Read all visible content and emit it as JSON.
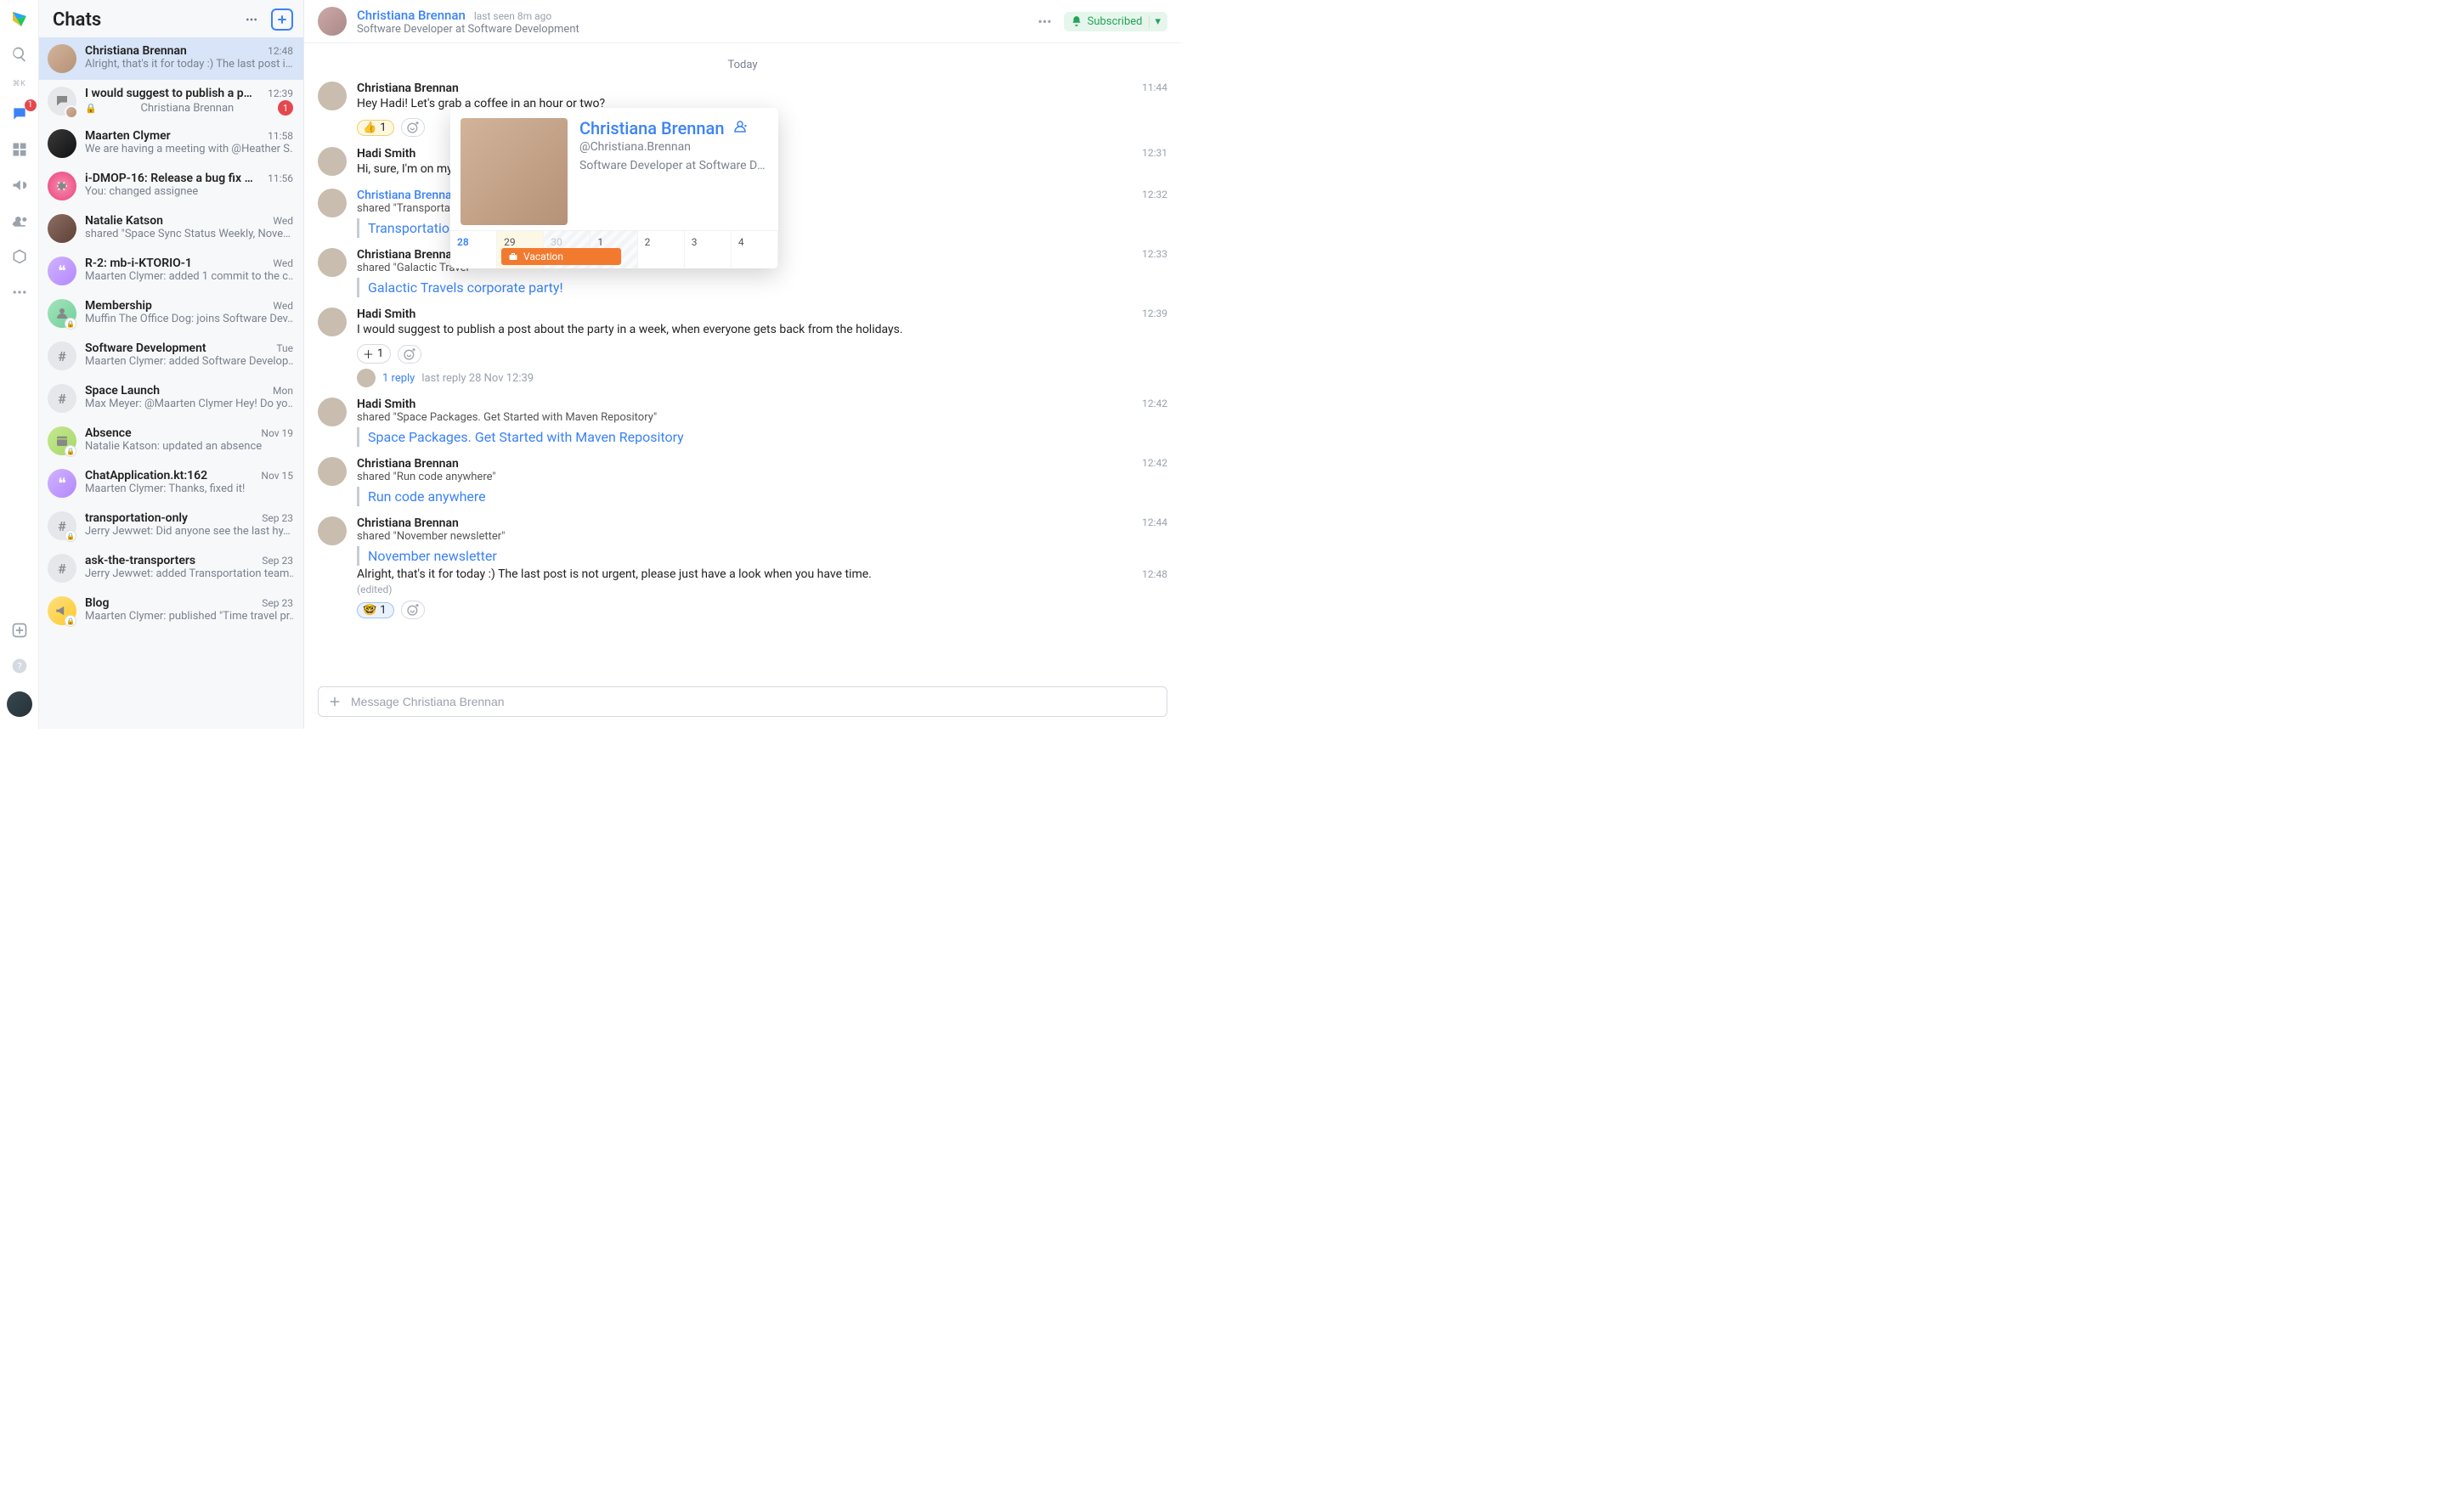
{
  "app": {
    "section_title": "Chats"
  },
  "rail": {
    "chats_badge": "1",
    "shortcut": "⌘K"
  },
  "header": {
    "name": "Christiana Brennan",
    "last_seen": "last seen 8m ago",
    "subtitle": "Software Developer at Software Development",
    "subscribed": "Subscribed"
  },
  "day_label": "Today",
  "composer": {
    "placeholder": "Message Christiana Brennan"
  },
  "chats": [
    {
      "title": "Christiana Brennan",
      "time": "12:48",
      "preview": "Alright, that's it for today :) The last post i…",
      "active": true,
      "avatar": "av-cb"
    },
    {
      "title": "I would suggest to publish a p…",
      "time": "12:39",
      "preview": "Christiana Brennan",
      "lock": true,
      "unread": "1",
      "thread": true,
      "mini": true
    },
    {
      "title": "Maarten Clymer",
      "time": "11:58",
      "preview": "We are having a meeting with @Heather S…",
      "avatar": "av-mc"
    },
    {
      "title": "i-DMOP-16: Release a bug fix …",
      "time": "11:56",
      "preview": "You: changed assignee",
      "avatar": "cv-pink",
      "icon": "bug"
    },
    {
      "title": "Natalie Katson",
      "time": "Wed",
      "preview": "shared \"Space Sync Status Weekly, Nove…",
      "avatar": "av-nk"
    },
    {
      "title": "R-2: mb-i-KTORIO-1",
      "time": "Wed",
      "preview": "Maarten Clymer: added 1 commit to the c…",
      "avatar": "cv-purple",
      "icon": "quote"
    },
    {
      "title": "Membership",
      "time": "Wed",
      "preview": "Muffin The Office Dog: joins Software Dev…",
      "avatar": "cv-green",
      "icon": "person",
      "corner_lock": true
    },
    {
      "title": "Software Development",
      "time": "Tue",
      "preview": "Maarten Clymer: added Software Develop…",
      "avatar": "cv-grey",
      "hash": true
    },
    {
      "title": "Space Launch",
      "time": "Mon",
      "preview": "Max Meyer: @Maarten Clymer Hey! Do yo…",
      "avatar": "cv-grey",
      "hash": true
    },
    {
      "title": "Absence",
      "time": "Nov 19",
      "preview": "Natalie Katson: updated an absence",
      "avatar": "cv-yellow-green",
      "icon": "calendar",
      "corner_lock": true
    },
    {
      "title": "ChatApplication.kt:162",
      "time": "Nov 15",
      "preview": "Maarten Clymer: Thanks, fixed it!",
      "avatar": "cv-purple",
      "icon": "quote"
    },
    {
      "title": "transportation-only",
      "time": "Sep 23",
      "preview": "Jerry Jewwet: Did anyone see the last hy…",
      "avatar": "cv-grey",
      "hash": true,
      "corner_lock": true
    },
    {
      "title": "ask-the-transporters",
      "time": "Sep 23",
      "preview": "Jerry Jewwet: added Transportation team…",
      "avatar": "cv-grey",
      "hash": true
    },
    {
      "title": "Blog",
      "time": "Sep 23",
      "preview": "Maarten Clymer: published \"Time travel pr…",
      "avatar": "cv-yellow",
      "icon": "megaphone",
      "corner_lock": true
    }
  ],
  "messages": [
    {
      "author": "Christiana Brennan",
      "avatar": "av-cb",
      "time": "11:44",
      "text": "Hey Hadi! Let's grab a coffee in an hour or two?",
      "react": {
        "emoji": "👍",
        "count": "1",
        "mine": true
      }
    },
    {
      "author": "Hadi Smith",
      "avatar": "av-hs",
      "time": "12:31",
      "text": "Hi, sure, I'm on my w"
    },
    {
      "author": "Christiana Brennan",
      "avatar": "av-cb",
      "link_author": true,
      "time": "12:32",
      "sub": "shared \"Transportation",
      "quote": "Transportation t"
    },
    {
      "author": "Christiana Brennan",
      "avatar": "av-cb",
      "time": "12:33",
      "sub": "shared \"Galactic Travel",
      "quote": "Galactic Travels corporate party!"
    },
    {
      "author": "Hadi Smith",
      "avatar": "av-hs",
      "time": "12:39",
      "text": "I would suggest to publish a post about the party in a week, when everyone gets back from the holidays.",
      "react": {
        "emoji": "＋",
        "count": "1"
      },
      "thread": {
        "replies": "1 reply",
        "last": "last reply 28 Nov 12:39"
      }
    },
    {
      "author": "Hadi Smith",
      "avatar": "av-hs",
      "time": "12:42",
      "sub": "shared \"Space Packages. Get Started with Maven Repository\"",
      "quote": "Space Packages. Get Started with Maven Repository"
    },
    {
      "author": "Christiana Brennan",
      "avatar": "av-cb",
      "time": "12:42",
      "sub": "shared \"Run code anywhere\"",
      "quote": "Run code anywhere"
    },
    {
      "author": "Christiana Brennan",
      "avatar": "av-cb",
      "time": "12:44",
      "sub": "shared \"November newsletter\"",
      "quote": "November newsletter",
      "tail_text": "Alright, that's it for today :) The last post is not urgent, please just have a look when you have time.",
      "tail_time": "12:48",
      "edited": "(edited)",
      "tail_react": {
        "emoji": "🤓",
        "count": "1",
        "mine": true
      }
    }
  ],
  "profile_card": {
    "name": "Christiana Brennan",
    "handle": "@Christiana.Brennan",
    "role": "Software Developer at Software Dev…",
    "days": [
      {
        "n": "28",
        "today": true
      },
      {
        "n": "29",
        "weekend": true
      },
      {
        "n": "30",
        "dim": true,
        "striped": true
      },
      {
        "n": "1",
        "striped": true
      },
      {
        "n": "2"
      },
      {
        "n": "3"
      },
      {
        "n": "4"
      }
    ],
    "event": "Vacation"
  }
}
